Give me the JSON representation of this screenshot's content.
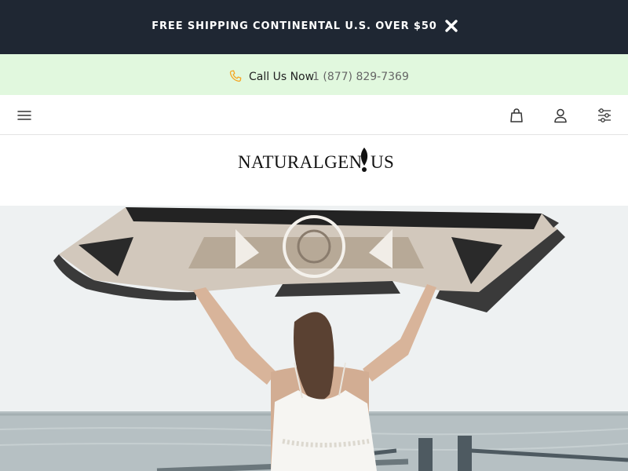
{
  "promo": {
    "text": "FREE SHIPPING CONTINENTAL U.S. OVER $50",
    "close_icon": "close-icon"
  },
  "contact": {
    "label": "Call Us Now",
    "phone": "1 (877) 829-7369",
    "icon": "phone-icon",
    "icon_color": "#f5a623"
  },
  "nav": {
    "menu_icon": "hamburger-menu-icon",
    "cart_icon": "shopping-bag-icon",
    "account_icon": "user-icon",
    "filter_icon": "sliders-icon"
  },
  "brand": {
    "logo_left": "NATURALGEN",
    "logo_right": "US",
    "logo_mark": "leaf-icon"
  },
  "colors": {
    "promo_bg": "#1f2733",
    "call_bg": "#e1f8de",
    "accent": "#f5a623"
  }
}
